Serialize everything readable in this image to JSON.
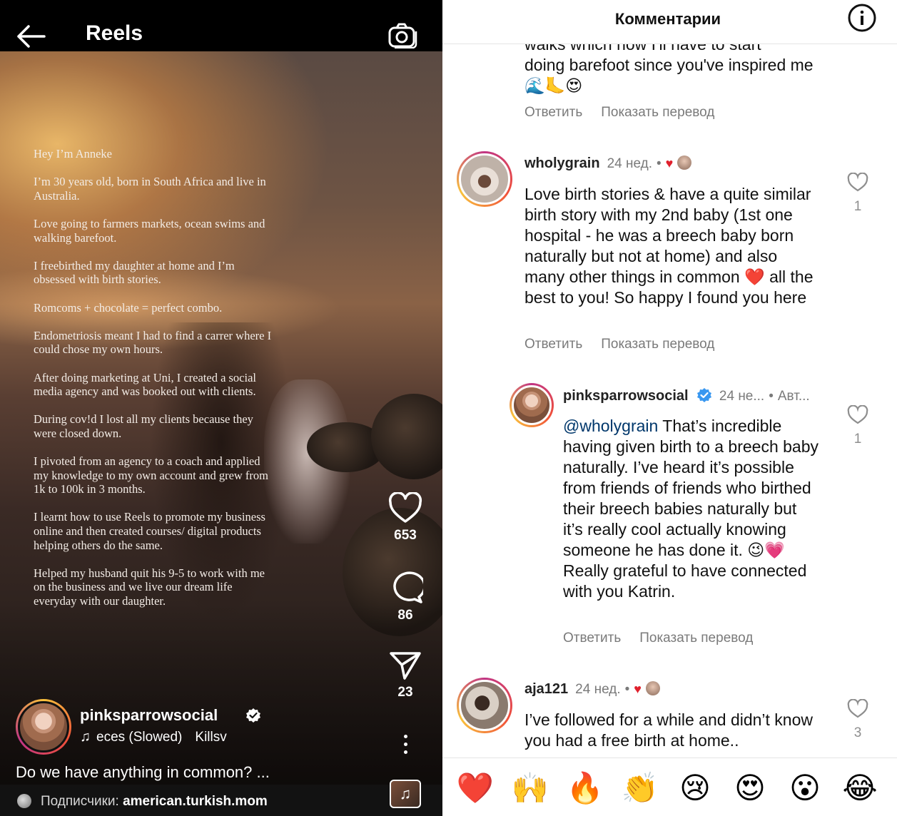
{
  "reels": {
    "title": "Reels",
    "caption_lines": [
      "Hey I’m Anneke",
      "I’m 30 years old, born in South Africa and live in Australia.",
      "Love going to farmers markets, ocean swims and walking barefoot.",
      "I freebirthed my daughter at home and I’m obsessed with birth stories.",
      "Romcoms + chocolate = perfect combo.",
      "Endometriosis meant I had to find a carrer where I could chose my own hours.",
      "After doing marketing at Uni, I created a social media agency and was booked out with clients.",
      "During cov!d I lost all my clients because they were closed down.",
      "I pivoted from an agency to a coach and applied my knowledge to my own account and grew from 1k to 100k in 3 months.",
      "I learnt how to use Reels to promote my business online and then created courses/ digital products helping others do the same.",
      "Helped my husband quit his 9-5 to work with me on the business and we live our dream life everyday with our daughter."
    ],
    "likes": "653",
    "comments": "86",
    "shares": "23",
    "author": "pinksparrowsocial",
    "music_track": "eces (Slowed)",
    "music_artist": "Killsv",
    "caption": "Do we have anything in common? ...",
    "followers_label": "Подписчики: ",
    "followers_user": "american.turkish.mom",
    "icons": {
      "back": "arrow-left-icon",
      "camera": "camera-icon",
      "like": "heart-icon",
      "comment": "comment-bubble-icon",
      "share": "paper-plane-icon",
      "verified": "verified-badge-icon",
      "music": "music-note-icon",
      "more": "more-vertical-icon"
    }
  },
  "comments_panel": {
    "title": "Комментарии",
    "reply_label": "Ответить",
    "translate_label": "Показать перевод",
    "top_partial": {
      "line_cut": "walks which now I'll have to start",
      "text": "doing barefoot since you've inspired me 🌊🦶😍"
    },
    "comments": [
      {
        "user": "wholygrain",
        "time": "24 нед.",
        "text": "Love birth stories & have a quite similar birth story with my 2nd baby (1st one hospital - he was a breech baby born naturally but not at home) and also many other things in common ❤️ all the best to you! So happy I found you here",
        "likes": "1"
      },
      {
        "user": "pinksparrowsocial",
        "time": "24 не...",
        "author_tag": "Авт...",
        "mention": "@wholygrain",
        "text": " That’s incredible having given birth to a breech baby naturally. I’ve heard it’s possible from friends of friends who birthed their breech babies naturally but it’s really cool actually knowing someone he has done it. 😉💗 Really grateful to have connected with you Katrin.",
        "likes": "1"
      },
      {
        "user": "aja121",
        "time": "24 нед.",
        "text": "I’ve followed for a while and didn’t know you had a free birth at home..",
        "likes": "3"
      }
    ],
    "reactions": [
      "❤️",
      "🙌",
      "🔥",
      "👏",
      "😢",
      "😍",
      "😮",
      "😂"
    ],
    "colors": {
      "accent_heart": "#e0202c",
      "verified": "#3897f0",
      "muted": "#7a7a7a"
    }
  }
}
